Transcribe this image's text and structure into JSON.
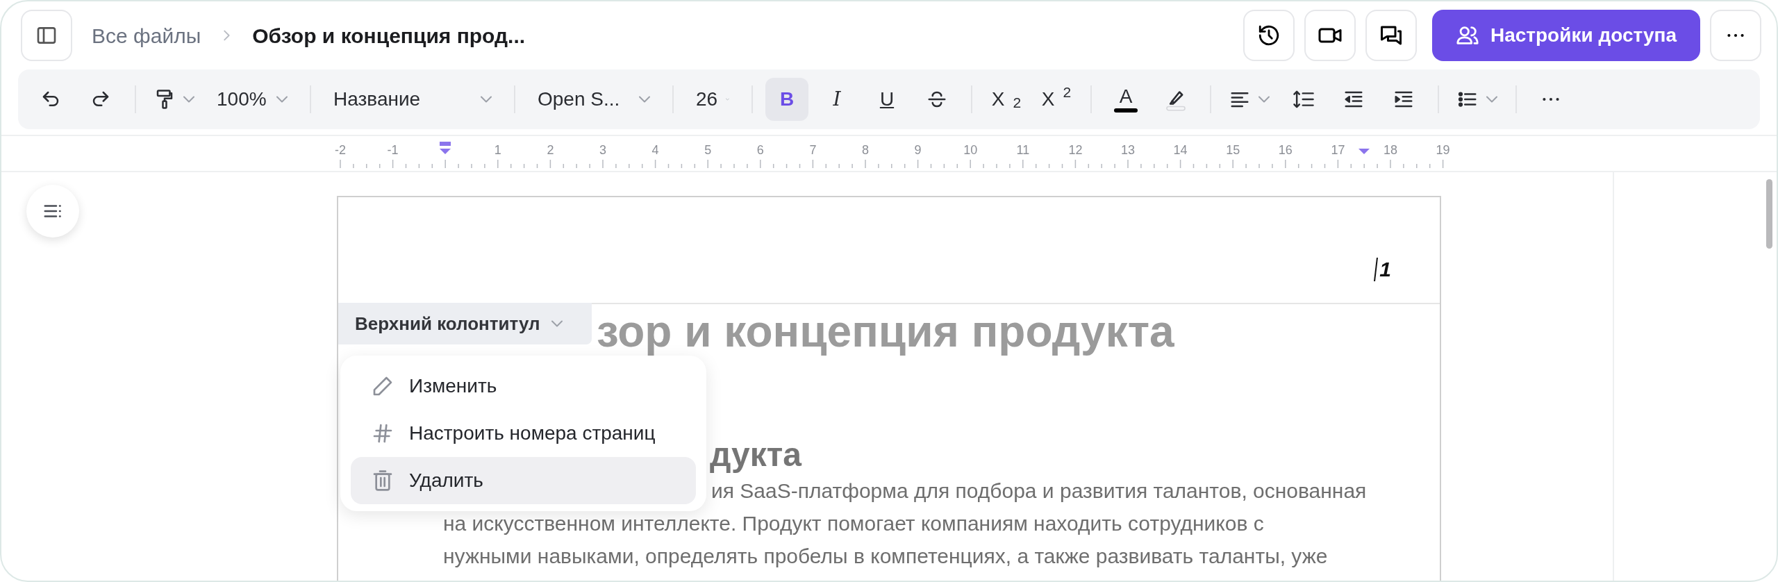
{
  "breadcrumb": {
    "root": "Все файлы",
    "title": "Обзор и концепция прод..."
  },
  "share_button": {
    "label": "Настройки доступа"
  },
  "toolbar": [
    {
      "kind": "undo"
    },
    {
      "kind": "redo"
    },
    {
      "kind": "divider"
    },
    {
      "kind": "paint_format"
    },
    {
      "kind": "dropdown",
      "value": "100%"
    },
    {
      "kind": "divider"
    },
    {
      "kind": "dropdown",
      "value": "Название"
    },
    {
      "kind": "divider"
    },
    {
      "kind": "dropdown",
      "value": "Open S..."
    },
    {
      "kind": "divider"
    },
    {
      "kind": "dropdown",
      "value": "26"
    },
    {
      "kind": "divider"
    },
    {
      "kind": "bold",
      "label": "B",
      "on": true
    },
    {
      "kind": "italic",
      "label": "I",
      "on": false
    },
    {
      "kind": "underline",
      "label": "U",
      "on": false
    },
    {
      "kind": "strike"
    },
    {
      "kind": "divider"
    },
    {
      "kind": "script",
      "label": "X$_{2}$"
    },
    {
      "kind": "script",
      "label": "X$^{2}$"
    },
    {
      "kind": "divider"
    },
    {
      "kind": "text_color",
      "label": "A"
    },
    {
      "kind": "highlight"
    },
    {
      "kind": "divider"
    },
    {
      "kind": "align"
    },
    {
      "kind": "line_spacing"
    },
    {
      "kind": "outdent"
    },
    {
      "kind": "indent"
    },
    {
      "kind": "divider"
    },
    {
      "kind": "list"
    },
    {
      "kind": "divider"
    },
    {
      "kind": "more"
    }
  ],
  "ruler": {
    "labels": [
      "-2",
      "-1",
      "1",
      "2",
      "3",
      "4",
      "5",
      "6",
      "7",
      "8",
      "9",
      "10",
      "11",
      "12",
      "13",
      "14",
      "15",
      "16",
      "17",
      "18",
      "19"
    ]
  },
  "page": {
    "header_text": "1",
    "header_label": "Верхний колонтитул",
    "title": "зор и концепция продукта",
    "heading": "дукта",
    "lines": [
      "ия SaaS-платформа для подбора и развития талантов, основанная",
      "на искусственном интеллекте. Продукт помогает компаниям находить сотрудников с",
      "нужными навыками, определять пробелы в компетенциях, а также развивать таланты, уже"
    ]
  },
  "menu": [
    {
      "kind": "edit",
      "label": "Изменить",
      "selected": false
    },
    {
      "kind": "page_numbers",
      "label": "Настроить номера страниц",
      "selected": false
    },
    {
      "kind": "delete",
      "label": "Удалить",
      "selected": true
    }
  ]
}
